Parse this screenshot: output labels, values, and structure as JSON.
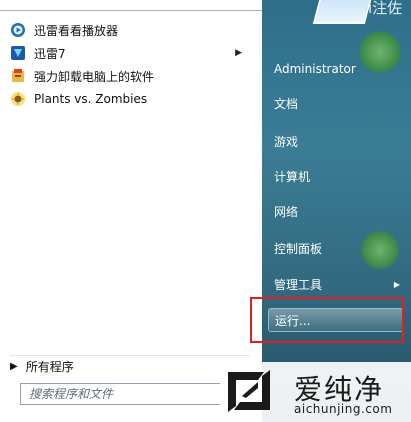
{
  "programs": [
    {
      "label": "迅雷看看播放器",
      "icon": "xunlei-kankan-icon",
      "has_submenu": false
    },
    {
      "label": "迅雷7",
      "icon": "xunlei7-icon",
      "has_submenu": true
    },
    {
      "label": "强力卸载电脑上的软件",
      "icon": "uninstall-icon",
      "has_submenu": false
    },
    {
      "label": "Plants vs. Zombies",
      "icon": "plants-vs-zombies-icon",
      "has_submenu": false
    }
  ],
  "all_programs_label": "所有程序",
  "search": {
    "placeholder": "搜索程序和文件"
  },
  "right_menu": [
    {
      "label": "Administrator"
    },
    {
      "label": "文档"
    },
    {
      "label": "游戏"
    },
    {
      "label": "计算机"
    },
    {
      "label": "网络"
    },
    {
      "label": "控制面板"
    },
    {
      "label": "管理工具",
      "has_submenu": true
    },
    {
      "label": "运行..."
    }
  ],
  "top_partial_text": "i注佐",
  "watermark": {
    "title": "爱纯净",
    "url": "aichunjing.com"
  },
  "colors": {
    "highlight": "#e0201c",
    "right_panel": "#3b7d95"
  }
}
